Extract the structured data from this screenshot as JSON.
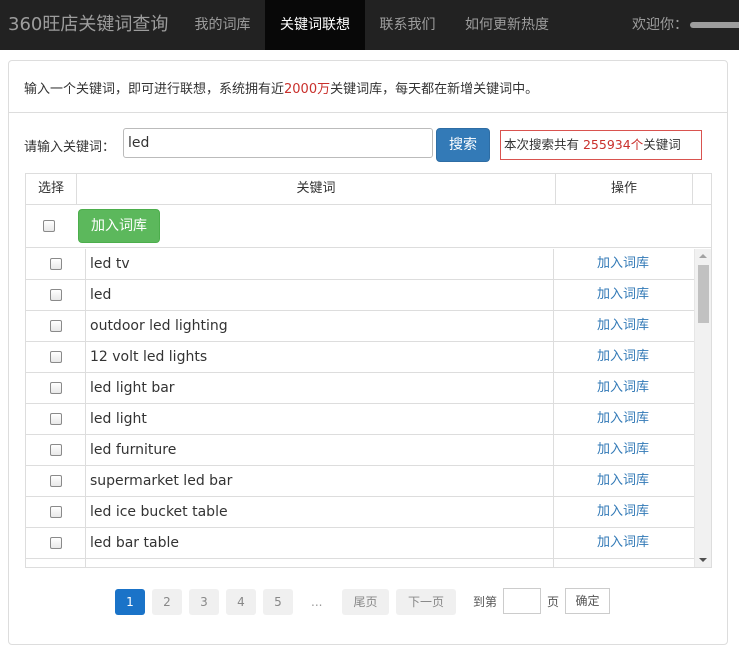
{
  "navbar": {
    "brand": "360旺店关键词查询",
    "items": [
      {
        "label": "我的词库"
      },
      {
        "label": "关键词联想"
      },
      {
        "label": "联系我们"
      },
      {
        "label": "如何更新热度"
      }
    ],
    "active_index": 1,
    "welcome": "欢迎你："
  },
  "intro": {
    "prefix": "输入一个关键词，即可进行联想，系统拥有近",
    "highlight": "2000万",
    "suffix": "关键词库，每天都在新增关键词中。"
  },
  "search": {
    "label": "请输入关键词：",
    "value": "led",
    "button": "搜索",
    "result_prefix": "本次搜索共有 ",
    "result_count": "255934个",
    "result_suffix": "关键词"
  },
  "table": {
    "headers": {
      "select": "选择",
      "keyword": "关键词",
      "action": "操作"
    },
    "add_button": "加入词库",
    "rows": [
      {
        "keyword": "led tv",
        "action": "加入词库"
      },
      {
        "keyword": "led",
        "action": "加入词库"
      },
      {
        "keyword": "outdoor led lighting",
        "action": "加入词库"
      },
      {
        "keyword": "12 volt led lights",
        "action": "加入词库"
      },
      {
        "keyword": "led light bar",
        "action": "加入词库"
      },
      {
        "keyword": "led light",
        "action": "加入词库"
      },
      {
        "keyword": "led furniture",
        "action": "加入词库"
      },
      {
        "keyword": "supermarket led bar",
        "action": "加入词库"
      },
      {
        "keyword": "led ice bucket table",
        "action": "加入词库"
      },
      {
        "keyword": "led bar table",
        "action": "加入词库"
      }
    ]
  },
  "pagination": {
    "pages": [
      "1",
      "2",
      "3",
      "4",
      "5"
    ],
    "current": "1",
    "ellipsis": "...",
    "last": "尾页",
    "next": "下一页",
    "goto_prefix": "到第",
    "goto_suffix": "页",
    "confirm": "确定"
  }
}
